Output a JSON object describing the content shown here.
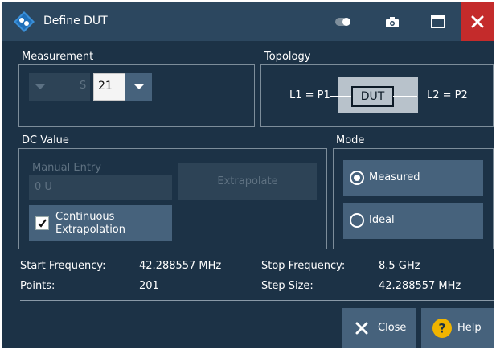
{
  "window": {
    "title": "Define DUT",
    "accent": "#c42b2b",
    "background": "#1c3246"
  },
  "measurement": {
    "group_title": "Measurement",
    "s_label": "S",
    "parameter_value": "21"
  },
  "topology": {
    "group_title": "Topology",
    "left_label": "L1 = P1",
    "dut_label": "DUT",
    "right_label": "L2 = P2"
  },
  "dc_value": {
    "group_title": "DC Value",
    "manual_entry_label": "Manual Entry",
    "manual_entry_value": "0 U",
    "extrapolate_label": "Extrapolate",
    "continuous_line1": "Continuous",
    "continuous_line2": "Extrapolation",
    "continuous_checked": true
  },
  "mode": {
    "group_title": "Mode",
    "options": [
      {
        "label": "Measured",
        "selected": true
      },
      {
        "label": "Ideal",
        "selected": false
      }
    ]
  },
  "info": {
    "start_frequency_label": "Start Frequency:",
    "start_frequency_value": "42.288557 MHz",
    "stop_frequency_label": "Stop Frequency:",
    "stop_frequency_value": "8.5 GHz",
    "points_label": "Points:",
    "points_value": "201",
    "step_size_label": "Step Size:",
    "step_size_value": "42.288557 MHz"
  },
  "buttons": {
    "close_label": "Close",
    "help_label": "Help"
  },
  "icons": {
    "app": "rohde-schwarz-logo-icon",
    "toggle": "toggle-icon",
    "camera": "camera-icon",
    "maximize": "maximize-icon",
    "close": "close-icon",
    "help": "help-icon"
  }
}
